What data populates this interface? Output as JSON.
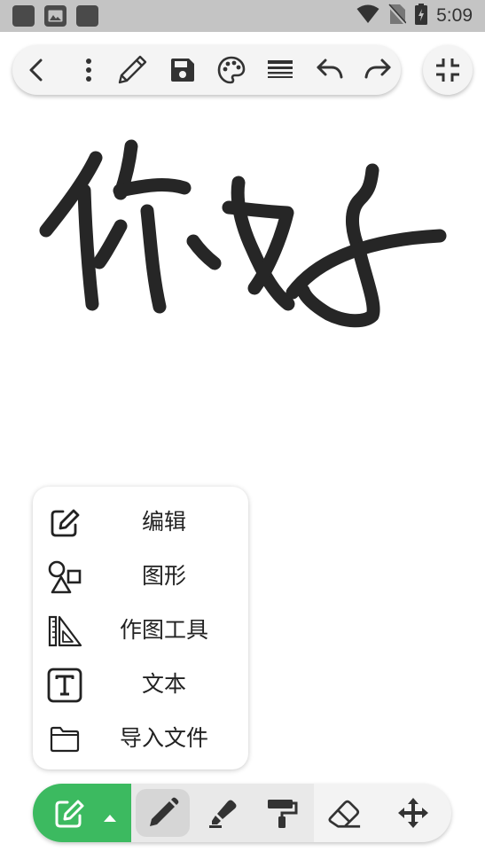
{
  "status_bar": {
    "time": "5:09",
    "icons": [
      "app-icon",
      "image-icon",
      "app-icon",
      "wifi-icon",
      "no-sim-icon",
      "battery-icon"
    ]
  },
  "top_toolbar": {
    "icons": [
      "back-icon",
      "more-vert-icon",
      "pencil-icon",
      "save-icon",
      "palette-icon",
      "line-width-icon",
      "undo-icon",
      "redo-icon"
    ],
    "fullscreen_icon": "fullscreen-exit-icon"
  },
  "canvas": {
    "stroke_color": "#262626"
  },
  "tool_menu": {
    "items": [
      {
        "label": "编辑",
        "icon": "edit-icon"
      },
      {
        "label": "图形",
        "icon": "shapes-icon"
      },
      {
        "label": "作图工具",
        "icon": "ruler-triangle-icon"
      },
      {
        "label": "文本",
        "icon": "text-icon"
      },
      {
        "label": "导入文件",
        "icon": "folder-icon"
      }
    ]
  },
  "bottom_toolbar": {
    "accent_color": "#3cba60",
    "mode_icon": "edit-icon",
    "tools": [
      {
        "name": "pen",
        "icon": "pen-icon",
        "selected": true
      },
      {
        "name": "highlighter",
        "icon": "highlighter-icon",
        "selected": false
      },
      {
        "name": "paint-roller",
        "icon": "paint-roller-icon",
        "selected": false
      },
      {
        "name": "eraser",
        "icon": "eraser-icon",
        "selected": false
      },
      {
        "name": "move",
        "icon": "move-icon",
        "selected": false
      }
    ]
  }
}
